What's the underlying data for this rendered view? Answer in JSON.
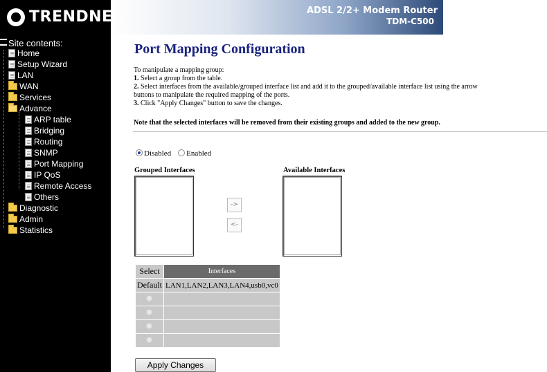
{
  "header": {
    "logo_text": "TRENDNET",
    "product_line": "ADSL 2/2+ Modem Router",
    "model": "TDM-C500"
  },
  "sidebar": {
    "title": "Site contents:",
    "items": [
      {
        "label": "Home",
        "icon": "doc-icon"
      },
      {
        "label": "Setup Wizard",
        "icon": "doc-icon"
      },
      {
        "label": "LAN",
        "icon": "doc-icon"
      },
      {
        "label": "WAN",
        "icon": "folder-icon"
      },
      {
        "label": "Services",
        "icon": "folder-icon"
      },
      {
        "label": "Advance",
        "icon": "open-folder-icon"
      },
      {
        "label": "ARP table",
        "icon": "doc-icon"
      },
      {
        "label": "Bridging",
        "icon": "doc-icon"
      },
      {
        "label": "Routing",
        "icon": "doc-icon"
      },
      {
        "label": "SNMP",
        "icon": "doc-icon"
      },
      {
        "label": "Port Mapping",
        "icon": "doc-icon"
      },
      {
        "label": "IP QoS",
        "icon": "doc-icon"
      },
      {
        "label": "Remote Access",
        "icon": "doc-icon"
      },
      {
        "label": "Others",
        "icon": "doc-icon"
      },
      {
        "label": "Diagnostic",
        "icon": "folder-icon"
      },
      {
        "label": "Admin",
        "icon": "folder-icon"
      },
      {
        "label": "Statistics",
        "icon": "folder-icon"
      }
    ]
  },
  "main": {
    "title": "Port Mapping Configuration",
    "intro": "To manipulate a mapping group:",
    "steps": [
      {
        "num": "1.",
        "text": " Select a group from the table."
      },
      {
        "num": "2.",
        "text": " Select interfaces from the available/grouped interface list and add it to the grouped/available interface list using the arrow"
      },
      {
        "num": "",
        "text": "buttons to manipulate the required mapping of the ports."
      },
      {
        "num": "3.",
        "text": " Click \"Apply Changes\" button to save the changes."
      }
    ],
    "note": "Note that the selected interfaces will be removed from their existing groups and added to the new group.",
    "mode": {
      "disabled_label": "Disabled",
      "enabled_label": "Enabled",
      "selected": "Disabled"
    },
    "grouped_label": "Grouped Interfaces",
    "available_label": "Available Interfaces",
    "add_arrow": "->",
    "remove_arrow": "<-",
    "table": {
      "headers": {
        "select": "Select",
        "interfaces": "Interfaces"
      },
      "rows": [
        {
          "select": "Default",
          "interfaces": "LAN1,LAN2,LAN3,LAN4,usb0,vc0"
        },
        {
          "select": "",
          "interfaces": ""
        },
        {
          "select": "",
          "interfaces": ""
        },
        {
          "select": "",
          "interfaces": ""
        },
        {
          "select": "",
          "interfaces": ""
        }
      ]
    },
    "apply_label": "Apply Changes"
  }
}
